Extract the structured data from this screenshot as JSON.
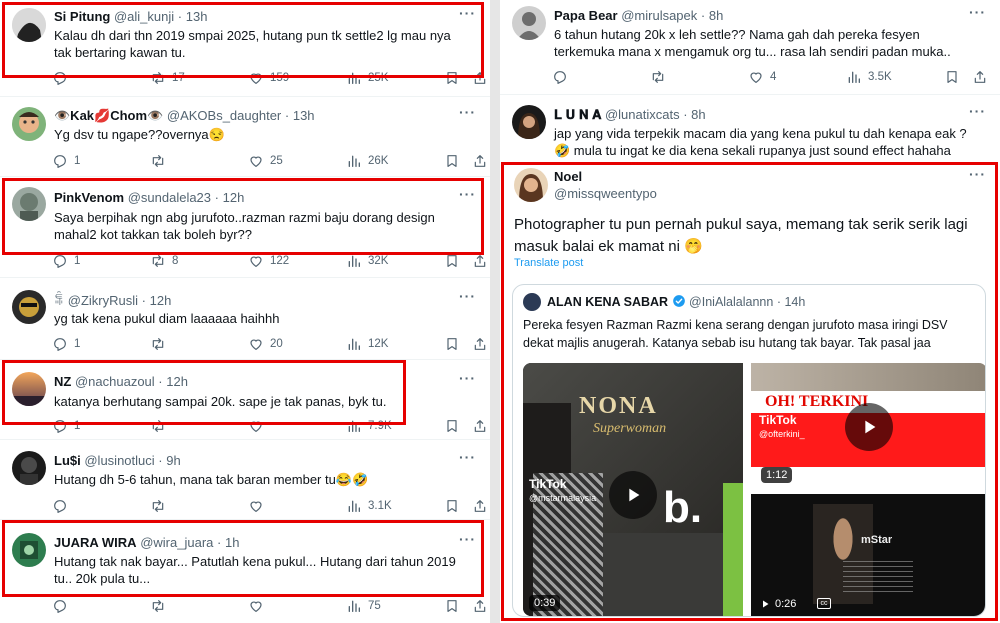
{
  "left_tweets": [
    {
      "name": "Si Pitung",
      "handle": "@ali_kunji",
      "time": "13h",
      "text": "Kalau dh dari thn 2019 smpai 2025, hutang pun tk settle2 lg mau nya tak bertaring kawan tu.",
      "replies": "",
      "reposts": "17",
      "likes": "159",
      "views": "25K"
    },
    {
      "name": "👁️Kak💋Chom👁️",
      "handle": "@AKOBs_daughter",
      "time": "13h",
      "text": "Yg dsv tu ngape??overnya😒",
      "replies": "1",
      "reposts": "",
      "likes": "25",
      "views": "26K"
    },
    {
      "name": "PinkVenom",
      "handle": "@sundalela23",
      "time": "12h",
      "text": "Saya berpihak ngn abg jurufoto..razman razmi baju dorang design mahal2 kot takkan tak boleh byr??",
      "replies": "1",
      "reposts": "8",
      "likes": "122",
      "views": "32K"
    },
    {
      "name": "",
      "handle": "ꁃ @ZikryRusli",
      "time": "12h",
      "text": "yg tak kena pukul diam laaaaaa haihhh",
      "replies": "1",
      "reposts": "",
      "likes": "20",
      "views": "12K"
    },
    {
      "name": "NZ",
      "handle": "@nachuazoul",
      "time": "12h",
      "text": "katanya berhutang sampai 20k. sape je tak panas, byk tu.",
      "replies": "1",
      "reposts": "",
      "likes": "",
      "views": "7.9K"
    },
    {
      "name": "Lu$i",
      "handle": "@lusinotluci",
      "time": "9h",
      "text": "Hutang dh 5-6 tahun, mana tak baran member tu😂🤣",
      "replies": "",
      "reposts": "",
      "likes": "",
      "views": "3.1K"
    },
    {
      "name": "JUARA WIRA",
      "handle": "@wira_juara",
      "time": "1h",
      "text": "Hutang tak nak bayar... Patutlah kena pukul... Hutang dari tahun 2019 tu.. 20k pula tu...",
      "replies": "",
      "reposts": "",
      "likes": "",
      "views": "75"
    }
  ],
  "right_tweets": [
    {
      "name": "Papa Bear",
      "handle": "@mirulsapek",
      "time": "8h",
      "text": "6 tahun hutang 20k x leh settle?? Nama gah dah pereka fesyen terkemuka mana x mengamuk org tu... rasa lah sendiri padan muka..",
      "replies": "",
      "reposts": "",
      "likes": "4",
      "views": "3.5K"
    },
    {
      "name": "𝐋 𝐔 𝐍 𝐀",
      "handle": "@lunatixcats",
      "time": "8h",
      "text": "jap yang vida terpekik macam dia yang kena pukul tu dah kenapa eak ? 🤣 mula tu ingat ke dia kena sekali rupanya just sound effect hahaha"
    }
  ],
  "featured": {
    "name": "Noel",
    "handle": "@missqweentypo",
    "text": "Photographer tu pun pernah pukul saya, memang tak serik serik lagi masuk balai ek mamat ni 🤭",
    "translate": "Translate post",
    "quote": {
      "name": "ALAN KENA SABAR",
      "handle": "@IniAlalalannn",
      "time": "14h",
      "text": "Pereka fesyen Razman Razmi kena serang dengan jurufoto masa iringi DSV dekat majlis anugerah. Katanya sebab isu hutang tak bayar. Tak pasal jaa",
      "media": [
        {
          "duration": "0:39",
          "tiktok": "TikTok",
          "tiktok_handle": "@mstarmalaysia",
          "sign": "NONA",
          "sign2": "Superwoman"
        },
        {
          "duration": "1:12",
          "tiktok": "TikTok",
          "tiktok_handle": "@ofterkini_",
          "banner": "OH! TERKINI"
        },
        {
          "duration": "0:26",
          "tiktok": "",
          "tiktok_handle": "",
          "mstar": "mStar"
        }
      ]
    }
  },
  "colors": {
    "highlight": "#e60000",
    "link": "#1d9bf0",
    "verified": "#1d9bf0",
    "muted": "#536471"
  }
}
